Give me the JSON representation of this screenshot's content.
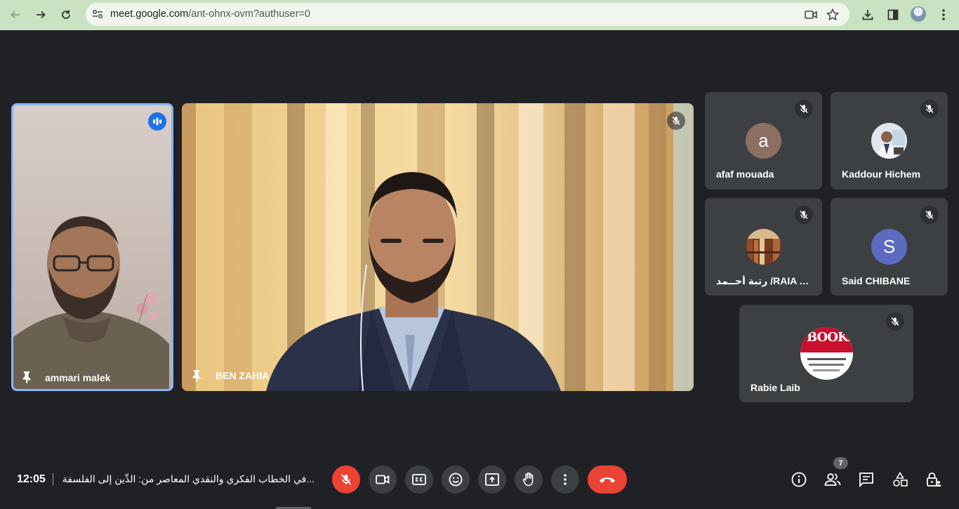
{
  "browser": {
    "url_host": "meet.google.com",
    "url_path": "/ant-ohnx-ovm?authuser=0"
  },
  "tiles": {
    "speaker": {
      "name": "ammari malek"
    },
    "main": {
      "name": "BEN ZAHIA"
    },
    "small": [
      {
        "name": "afaf mouada",
        "avatar_letter": "a",
        "avatar_color": "#8d6e63"
      },
      {
        "name": "Kaddour Hichem"
      },
      {
        "name": "رتبة أحــمد /RAIA AH..."
      },
      {
        "name": "Said CHIBANE",
        "avatar_letter": "S",
        "avatar_color": "#5c6bc0"
      },
      {
        "name": "Rabie Laib",
        "avatar_text": "BOOKS"
      }
    ]
  },
  "bottom": {
    "time": "12:05",
    "meeting_title": "...في الخطاب الفكري والنقدي المعاصر من: الدِّين إلى الفلسفة إلى النقد.",
    "participant_count": "7"
  },
  "colors": {
    "accent_blue": "#8ab4f8",
    "danger_red": "#ea4335",
    "tile_bg": "#3c4043",
    "page_bg": "#202124"
  }
}
